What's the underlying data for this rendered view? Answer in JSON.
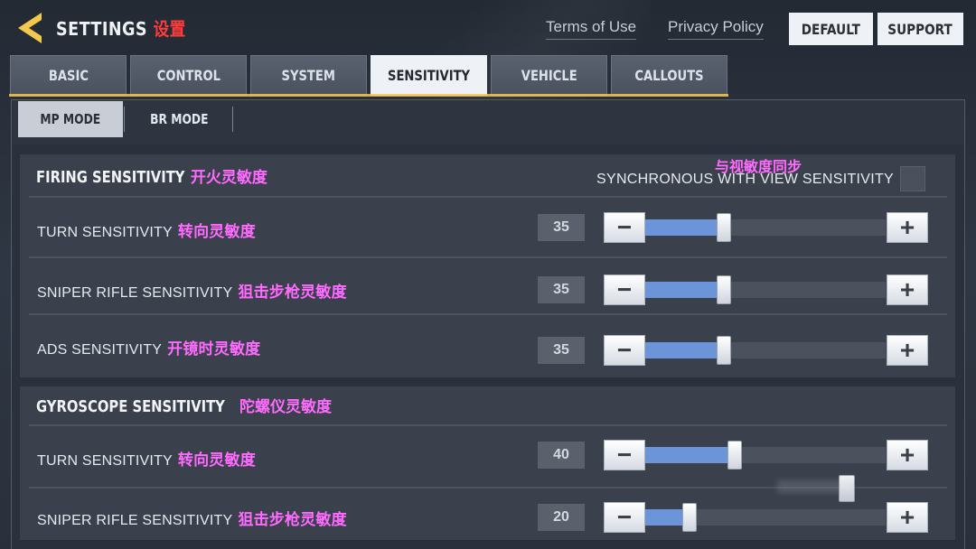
{
  "header": {
    "title": "SETTINGS",
    "title_cn": "设置",
    "terms_label": "Terms of Use",
    "privacy_label": "Privacy Policy",
    "default_label": "DEFAULT",
    "support_label": "SUPPORT"
  },
  "tabs": [
    {
      "label": "BASIC",
      "active": false
    },
    {
      "label": "CONTROL",
      "active": false
    },
    {
      "label": "SYSTEM",
      "active": false
    },
    {
      "label": "SENSITIVITY",
      "active": true
    },
    {
      "label": "VEHICLE",
      "active": false
    },
    {
      "label": "CALLOUTS",
      "active": false
    }
  ],
  "subtabs": [
    {
      "label": "MP MODE",
      "active": true
    },
    {
      "label": "BR MODE",
      "active": false
    }
  ],
  "colors": {
    "accent_fill": "#6c94d8",
    "annotation_cn": "#ff6bff",
    "title_cn": "#ff3b3b",
    "back_arrow": "#f2c94c"
  },
  "firing": {
    "title": "FIRING SENSITIVITY",
    "title_cn": "开火灵敏度",
    "sync_label": "SYNCHRONOUS WITH VIEW SENSITIVITY",
    "sync_cn": "与视敏度同步",
    "sync_checked": false,
    "rows": [
      {
        "label": "TURN SENSITIVITY",
        "label_cn": "转向灵敏度",
        "value": "35",
        "level": 0.35
      },
      {
        "label": "SNIPER RIFLE SENSITIVITY",
        "label_cn": "狙击步枪灵敏度",
        "value": "35",
        "level": 0.35
      },
      {
        "label": "ADS SENSITIVITY",
        "label_cn": "开镜时灵敏度",
        "value": "35",
        "level": 0.35
      }
    ]
  },
  "gyro": {
    "title": "GYROSCOPE SENSITIVITY",
    "title_cn": "陀螺仪灵敏度",
    "rows": [
      {
        "label": "TURN SENSITIVITY",
        "label_cn": "转向灵敏度",
        "value": "40",
        "level": 0.4
      },
      {
        "label": "SNIPER RIFLE SENSITIVITY",
        "label_cn": "狙击步枪灵敏度",
        "value": "20",
        "level": 0.2
      }
    ]
  },
  "icons": {
    "back": "back-arrow-icon",
    "minus": "minus-icon",
    "plus": "plus-icon",
    "checkbox": "checkbox-icon"
  }
}
